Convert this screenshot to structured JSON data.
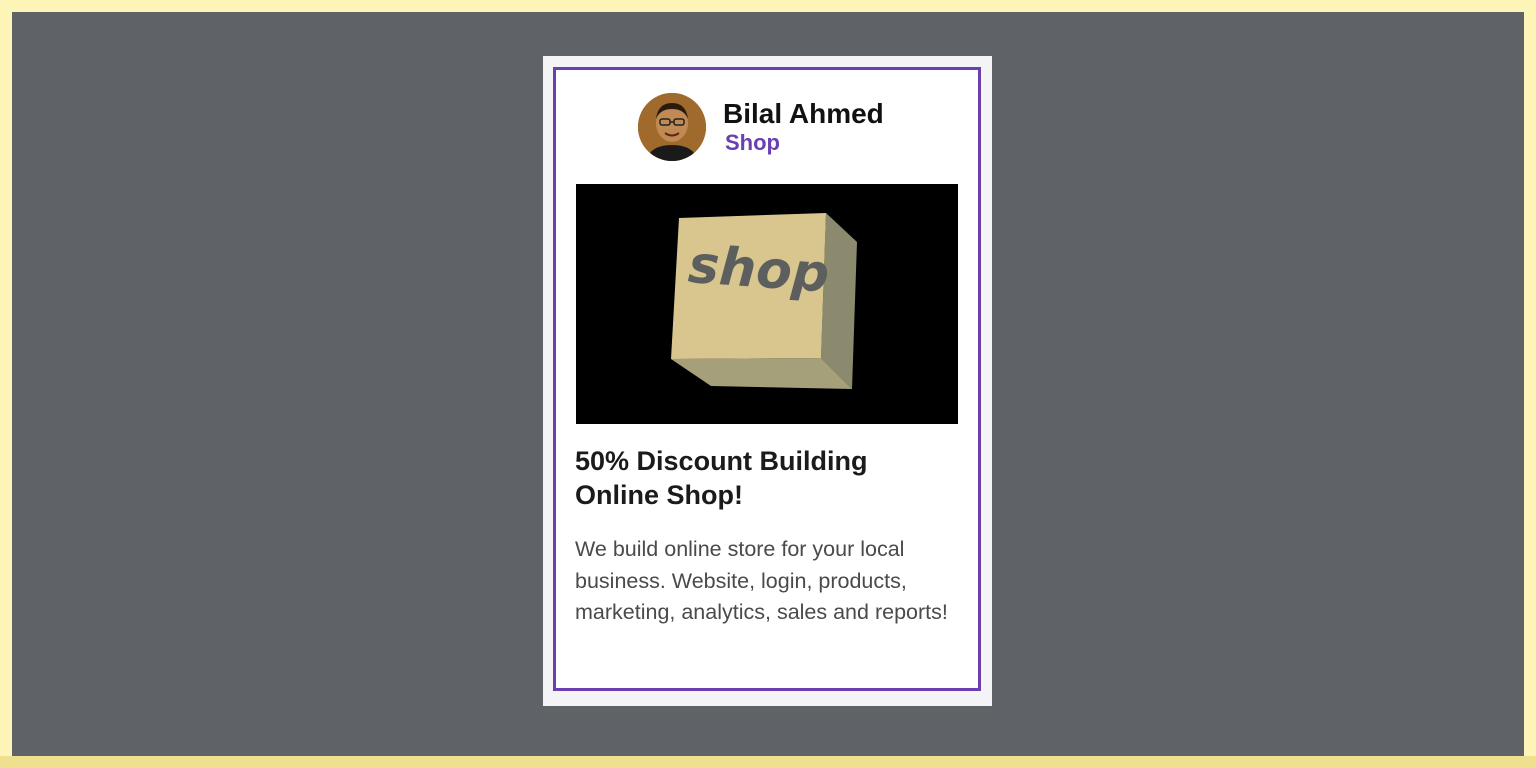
{
  "card": {
    "author": {
      "name": "Bilal Ahmed",
      "role": "Shop",
      "avatar": "person-avatar"
    },
    "image": {
      "icon": "shop-box",
      "text": "shop"
    },
    "title": "50% Discount Building Online Shop!",
    "description": "We build online store for your local business. Website, login, products, marketing, analytics, sales and reports!"
  },
  "colors": {
    "accent": "#6b3fb0",
    "background": "#5f6367",
    "frame": "#fdf4b8"
  }
}
